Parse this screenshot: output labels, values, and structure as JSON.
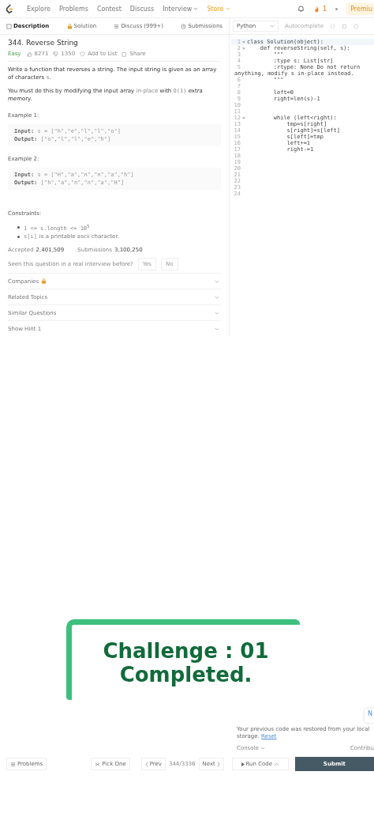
{
  "nav": {
    "items": [
      {
        "label": "Explore",
        "kind": "link"
      },
      {
        "label": "Problems",
        "kind": "link"
      },
      {
        "label": "Contest",
        "kind": "link"
      },
      {
        "label": "Discuss",
        "kind": "link"
      },
      {
        "label": "Interview",
        "kind": "dropdown"
      },
      {
        "label": "Store",
        "kind": "store"
      }
    ],
    "streak": "1",
    "premium": "Premiu"
  },
  "tabs": [
    {
      "label": "Description",
      "selected": true
    },
    {
      "label": "Solution",
      "selected": false
    },
    {
      "label": "Discuss (999+)",
      "selected": false
    },
    {
      "label": "Submissions",
      "selected": false
    }
  ],
  "problem": {
    "title": "344. Reverse String",
    "difficulty": "Easy",
    "likes": "8271",
    "dislikes": "1350",
    "add_to_list": "Add to List",
    "share": "Share",
    "paragraphs": [
      [
        {
          "text": "Write a function that reverses a string. The input string is given as an array of characters ",
          "kind": "plain"
        },
        {
          "text": "s",
          "kind": "code"
        },
        {
          "text": ".",
          "kind": "plain"
        }
      ],
      [
        {
          "text": "You must do this by modifying the input array ",
          "kind": "plain"
        },
        {
          "text": "in-place",
          "kind": "link"
        },
        {
          "text": " with ",
          "kind": "plain"
        },
        {
          "text": "O(1)",
          "kind": "code"
        },
        {
          "text": " extra memory.",
          "kind": "plain"
        }
      ]
    ],
    "examples": [
      {
        "title": "Example 1:",
        "input_label": "Input:",
        "input": "s = [\"h\",\"e\",\"l\",\"l\",\"o\"]",
        "output_label": "Output:",
        "output": "[\"o\",\"l\",\"l\",\"e\",\"h\"]"
      },
      {
        "title": "Example 2:",
        "input_label": "Input:",
        "input": "s = [\"H\",\"a\",\"n\",\"n\",\"a\",\"h\"]",
        "output_label": "Output:",
        "output": "[\"h\",\"a\",\"n\",\"n\",\"a\",\"H\"]"
      }
    ],
    "constraints_title": "Constraints:",
    "constraints": [
      {
        "code": "1 <= s.length <= 10$^{5}$"
      },
      {
        "code": "s[i]",
        "text": "is a printable ascii character."
      }
    ],
    "accepted_label": "Accepted",
    "accepted": "2,401,509",
    "submissions_label": "Submissions",
    "submissions": "3,100,250",
    "interview_question": "Seen this question in a real interview before?",
    "answers": [
      "Yes",
      "No"
    ],
    "sections": [
      {
        "label": "Companies",
        "locked": true
      },
      {
        "label": "Related Topics",
        "locked": false
      },
      {
        "label": "Similar Questions",
        "locked": false
      },
      {
        "label": "Show Hint 1",
        "locked": false
      }
    ]
  },
  "editor": {
    "language": "Python",
    "autocomplete": "Autocomplete",
    "lines": [
      {
        "number": "1",
        "text": "class Solution(object):",
        "fold": true
      },
      {
        "number": "2",
        "text": "    def reverseString(self, s):",
        "fold": true
      },
      {
        "number": "3",
        "text": "        \"\"\"",
        "fold": false
      },
      {
        "number": "4",
        "text": "        :type s: List[str]",
        "fold": false
      },
      {
        "number": "5",
        "text": "        :rtype: None Do not return",
        "fold": false,
        "continuation": "anything, modify s in-place instead."
      },
      {
        "number": "6",
        "text": "        \"\"\"",
        "fold": false
      },
      {
        "number": "7",
        "fold": false
      },
      {
        "number": "8",
        "text": "        left=0",
        "fold": false
      },
      {
        "number": "9",
        "text": "        right=len(s)-1",
        "fold": false
      },
      {
        "number": "10",
        "fold": false
      },
      {
        "number": "11",
        "fold": false
      },
      {
        "number": "12",
        "text": "        while (left<right):",
        "fold": true
      },
      {
        "number": "13",
        "text": "            tmp=s[right]",
        "fold": false
      },
      {
        "number": "14",
        "text": "            s[right]=s[left]",
        "fold": false
      },
      {
        "number": "15",
        "text": "            s[left]=tmp",
        "fold": false
      },
      {
        "number": "16",
        "text": "            left+=1",
        "fold": false
      },
      {
        "number": "17",
        "text": "            right-=1",
        "fold": false
      },
      {
        "number": "18",
        "fold": false
      },
      {
        "number": "19",
        "fold": false
      },
      {
        "number": "20",
        "fold": false
      },
      {
        "number": "21",
        "fold": false
      },
      {
        "number": "22",
        "fold": false
      },
      {
        "number": "23",
        "fold": false
      },
      {
        "number": "24",
        "fold": false
      }
    ],
    "side_button": "N",
    "restored": "Your previous code was restored from your local storage.",
    "reset": "Reset",
    "console": "Console",
    "contribute": "Contribu"
  },
  "overlay": {
    "lines": [
      "Challenge : 01",
      "Completed."
    ]
  },
  "bottom_bar": {
    "problems": "Problems",
    "pick_one": "Pick One",
    "prev": "Prev",
    "position": "344/3336",
    "next": "Next",
    "run_code": "Run Code",
    "submit": "Submit"
  }
}
